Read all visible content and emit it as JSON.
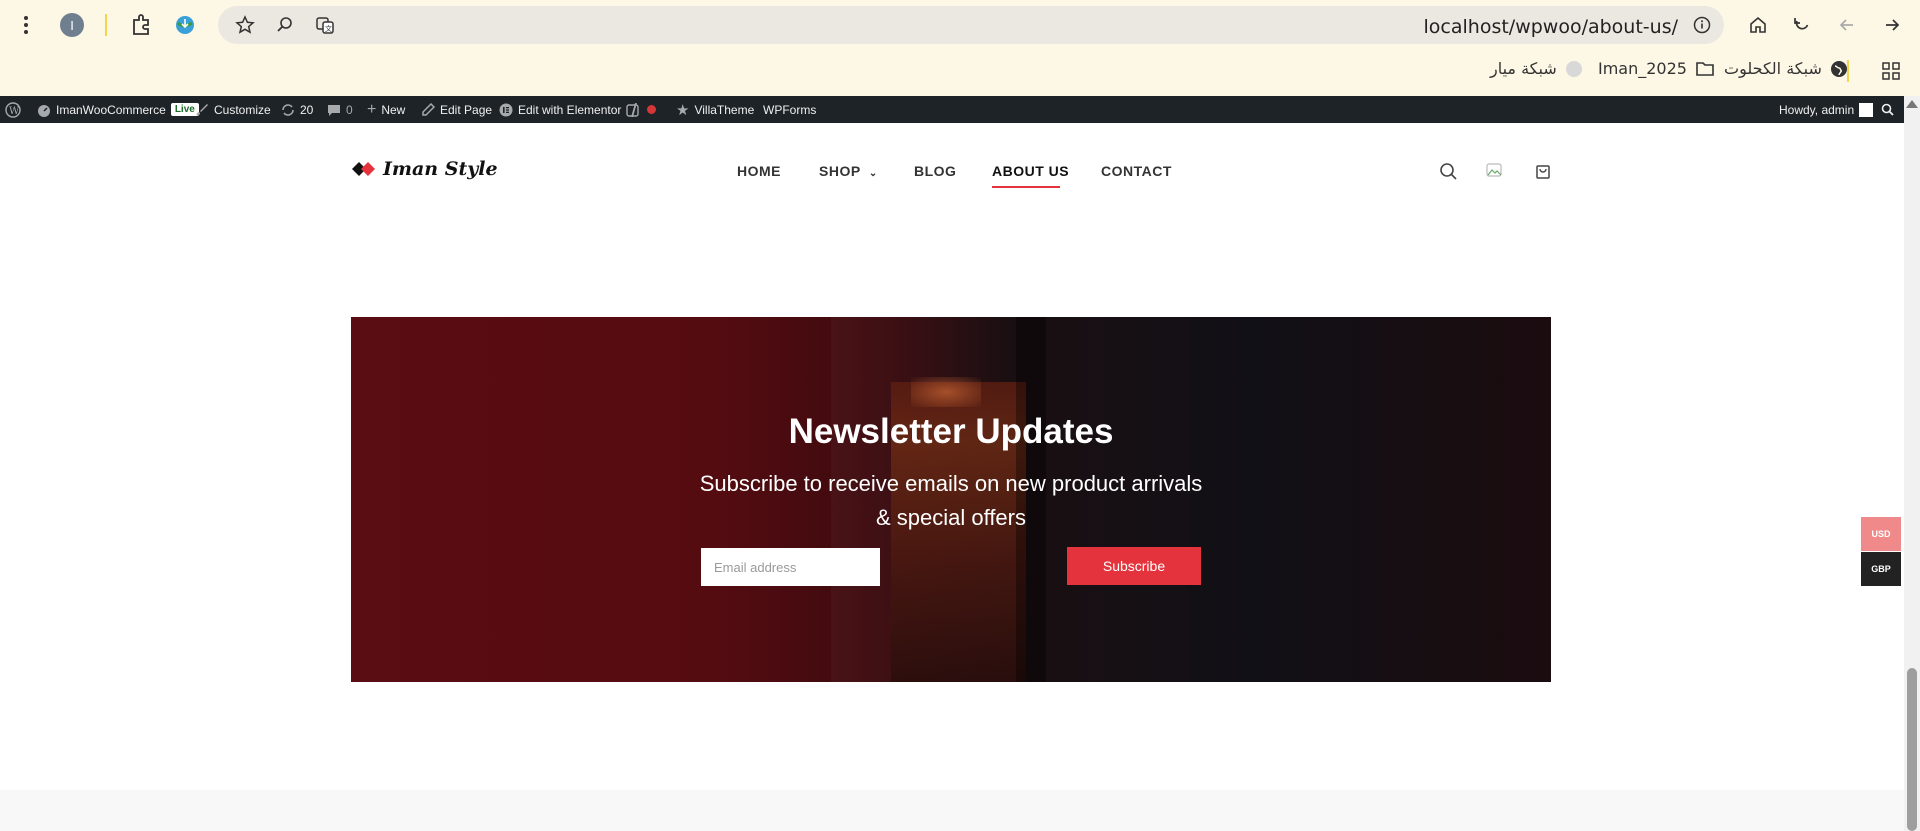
{
  "browser": {
    "url": "localhost/wpwoo/about-us/",
    "profile_initial": "I",
    "bookmarks": [
      {
        "label": "شبكة الكحلوت",
        "icon": "globe-icon"
      },
      {
        "label": "Iman_2025",
        "icon": "folder-icon"
      },
      {
        "label": "شبكة ميار",
        "icon": "moon-icon"
      }
    ]
  },
  "wpbar": {
    "site_name": "ImanWooCommerce",
    "live_label": "Live",
    "customize": "Customize",
    "updates_count": "20",
    "comments_count": "0",
    "new_label": "New",
    "edit_page": "Edit Page",
    "edit_elementor": "Edit with Elementor",
    "villatheme": "VillaTheme",
    "wpforms": "WPForms",
    "howdy": "Howdy, admin"
  },
  "header": {
    "logo_text": "Iman Style",
    "nav": [
      "HOME",
      "SHOP",
      "BLOG",
      "ABOUT US",
      "CONTACT"
    ],
    "active_nav": "ABOUT US"
  },
  "newsletter": {
    "title": "Newsletter Updates",
    "subtitle_line1": "Subscribe to receive emails on new product arrivals",
    "subtitle_line2": "& special offers",
    "email_placeholder": "Email address",
    "button_label": "Subscribe"
  },
  "currency": {
    "options": [
      "USD",
      "GBP"
    ],
    "selected": "GBP"
  },
  "colors": {
    "accent": "#e4333c",
    "wpbar": "#1d2327",
    "browser_bg": "#fdf7e6"
  }
}
